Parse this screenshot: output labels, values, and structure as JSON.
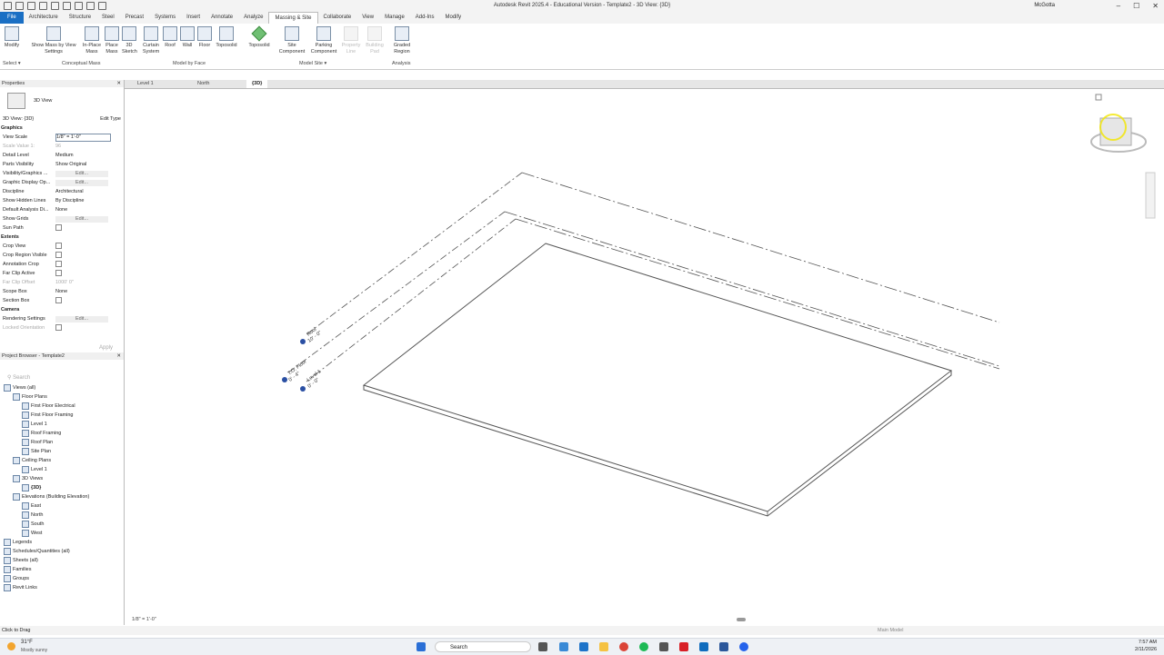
{
  "titlebar": {
    "title": "Autodesk Revit 2025.4 - Educational Version - Template2 - 3D View: {3D}",
    "user": "McGotta"
  },
  "menu": {
    "tabs": [
      "File",
      "Architecture",
      "Structure",
      "Steel",
      "Precast",
      "Systems",
      "Insert",
      "Annotate",
      "Analyze",
      "Massing & Site",
      "Collaborate",
      "View",
      "Manage",
      "Add-Ins",
      "Modify"
    ],
    "active": "Massing & Site"
  },
  "ribbon": {
    "modify": "Modify",
    "select": "Select ▾",
    "show_mass": "Show Mass by View Settings",
    "inplace": "In-Place Mass",
    "place_mass": "Place Mass",
    "sketch3d": "3D Sketch",
    "curtain": "Curtain System",
    "roof": "Roof",
    "wall": "Wall",
    "floor": "Floor",
    "toposolid": "Toposolid",
    "toposolid2": "Toposolid",
    "site_comp": "Site Component",
    "parking": "Parking Component",
    "dis1": "Property Line",
    "dis2": "Building Pad",
    "graded": "Graded Region",
    "panels": {
      "conceptual": "Conceptual Mass",
      "model_face": "Model by Face",
      "model_site": "Model Site ▾",
      "analysis": "Analysis"
    }
  },
  "properties": {
    "header": "Properties",
    "type": "3D View",
    "instance": "3D View: {3D}",
    "edit_type": "Edit Type",
    "sections": {
      "graphics": "Graphics",
      "extents": "Extents",
      "camera": "Camera"
    },
    "graphics_rows": [
      {
        "k": "View Scale",
        "v": "1/8\" = 1'-0\""
      },
      {
        "k": "Scale Value 1:",
        "v": "96"
      },
      {
        "k": "Detail Level",
        "v": "Medium"
      },
      {
        "k": "Parts Visibility",
        "v": "Show Original"
      },
      {
        "k": "Visibility/Graphics ...",
        "v": "Edit..."
      },
      {
        "k": "Graphic Display Op...",
        "v": "Edit..."
      },
      {
        "k": "Discipline",
        "v": "Architectural"
      },
      {
        "k": "Show Hidden Lines",
        "v": "By Discipline"
      },
      {
        "k": "Default Analysis Di...",
        "v": "None"
      },
      {
        "k": "Show Grids",
        "v": "Edit..."
      },
      {
        "k": "Sun Path",
        "v": ""
      }
    ],
    "extents_rows": [
      {
        "k": "Crop View",
        "v": ""
      },
      {
        "k": "Crop Region Visible",
        "v": ""
      },
      {
        "k": "Annotation Crop",
        "v": ""
      },
      {
        "k": "Far Clip Active",
        "v": ""
      },
      {
        "k": "Far Clip Offset",
        "v": "1000' 0\""
      },
      {
        "k": "Scope Box",
        "v": "None"
      },
      {
        "k": "Section Box",
        "v": ""
      }
    ],
    "camera_rows": [
      {
        "k": "Rendering Settings",
        "v": "Edit..."
      },
      {
        "k": "Locked Orientation",
        "v": ""
      }
    ],
    "apply": "Apply"
  },
  "browser": {
    "header": "Project Browser - Template2",
    "search": "Search",
    "tree": [
      {
        "t": "Views (all)",
        "d": 0
      },
      {
        "t": "Floor Plans",
        "d": 1
      },
      {
        "t": "First Floor Electrical",
        "d": 2
      },
      {
        "t": "First Floor Framing",
        "d": 2
      },
      {
        "t": "Level 1",
        "d": 2
      },
      {
        "t": "Roof Framing",
        "d": 2
      },
      {
        "t": "Roof Plan",
        "d": 2
      },
      {
        "t": "Site Plan",
        "d": 2
      },
      {
        "t": "Ceiling Plans",
        "d": 1
      },
      {
        "t": "Level 1",
        "d": 2
      },
      {
        "t": "3D Views",
        "d": 1
      },
      {
        "t": "{3D}",
        "d": 2
      },
      {
        "t": "Elevations (Building Elevation)",
        "d": 1
      },
      {
        "t": "East",
        "d": 2
      },
      {
        "t": "North",
        "d": 2
      },
      {
        "t": "South",
        "d": 2
      },
      {
        "t": "West",
        "d": 2
      },
      {
        "t": "Legends",
        "d": 0
      },
      {
        "t": "Schedules/Quantities (all)",
        "d": 0
      },
      {
        "t": "Sheets (all)",
        "d": 0
      },
      {
        "t": "Families",
        "d": 0
      },
      {
        "t": "Groups",
        "d": 0
      },
      {
        "t": "Revit Links",
        "d": 0
      }
    ]
  },
  "viewtabs": [
    "Level 1",
    "North",
    "{3D}"
  ],
  "levels": {
    "roof": "Roof",
    "roof_elev": "10' - 0\"",
    "tofloor": "T.O. Floor",
    "tofloor_elev": "0' - 4\"",
    "level1": "Level 1",
    "level1_elev": "0' - 0\""
  },
  "viewctl": {
    "scale": "1/8\" = 1'-0\""
  },
  "status": {
    "left": "Click to Drag",
    "model": "Main Model"
  },
  "taskbar": {
    "weather_temp": "31°F",
    "weather_desc": "Mostly sunny",
    "search": "Search",
    "time": "7:57 AM",
    "date": "2/11/2026"
  }
}
